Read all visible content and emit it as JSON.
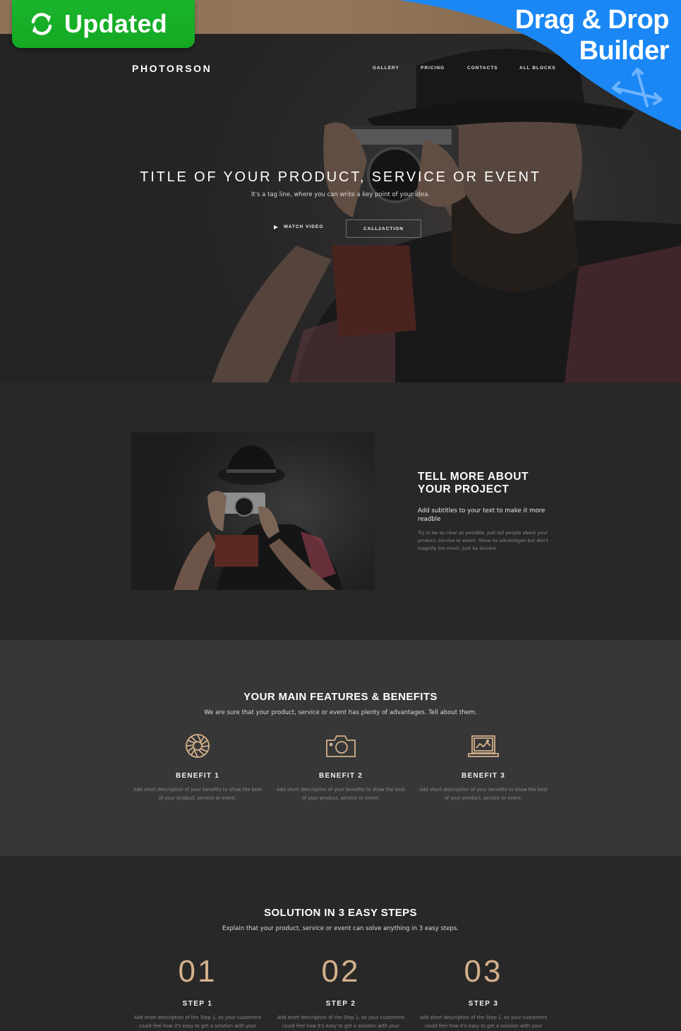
{
  "badges": {
    "updated_label": "Updated",
    "dnd_line1": "Drag & Drop",
    "dnd_line2": "Builder",
    "green": "#19b52d",
    "blue": "#1a87f4"
  },
  "header": {
    "logo": "PHOTORSON",
    "nav": [
      {
        "label": "GALLERY"
      },
      {
        "label": "PRICING"
      },
      {
        "label": "CONTACTS"
      },
      {
        "label": "ALL BLOCKS"
      }
    ]
  },
  "hero": {
    "title": "TITLE OF YOUR PRODUCT, SERVICE OR EVENT",
    "tagline": "It's a tag line, where you can write a key point of your idea.",
    "watch_video": "WATCH VIDEO",
    "cta": "CALL2ACTION"
  },
  "about": {
    "title_line1": "TELL MORE ABOUT",
    "title_line2": "YOUR PROJECT",
    "subtitle": "Add subtitles to your text to make it more readble",
    "body": "Try to be as clear as possible. Just tell people about your product, service or event. Show its advantages but don't magnify too much. Just be sincere."
  },
  "features": {
    "title": "YOUR MAIN FEATURES & BENEFITS",
    "subtitle": "We are sure that your product, service or event has plenty of advantages. Tell about them.",
    "items": [
      {
        "icon": "aperture-icon",
        "title": "BENEFIT 1",
        "desc": "Add short description of your benefits to show the best of your product, service or event."
      },
      {
        "icon": "camera-icon",
        "title": "BENEFIT 2",
        "desc": "Add short description of your benefits to show the best of your product, service or event."
      },
      {
        "icon": "laptop-image-icon",
        "title": "BENEFIT 3",
        "desc": "Add short description of your benefits to show the best of your product, service or event."
      }
    ],
    "accent": "#d4b08b"
  },
  "steps": {
    "title": "SOLUTION IN 3 EASY STEPS",
    "subtitle": "Explain that your product, service or event can solve anything in 3 easy steps.",
    "items": [
      {
        "num": "01",
        "title": "STEP 1",
        "desc": "Add short description of the Step 1, so your customers could feel how it's easy to get a solution with your"
      },
      {
        "num": "02",
        "title": "STEP 2",
        "desc": "Add short description of the Step 1, so your customers could feel how it's easy to get a solution with your"
      },
      {
        "num": "03",
        "title": "STEP 3",
        "desc": "Add short description of the Step 1, so your customers could feel how it's easy to get a solution with your"
      }
    ]
  }
}
